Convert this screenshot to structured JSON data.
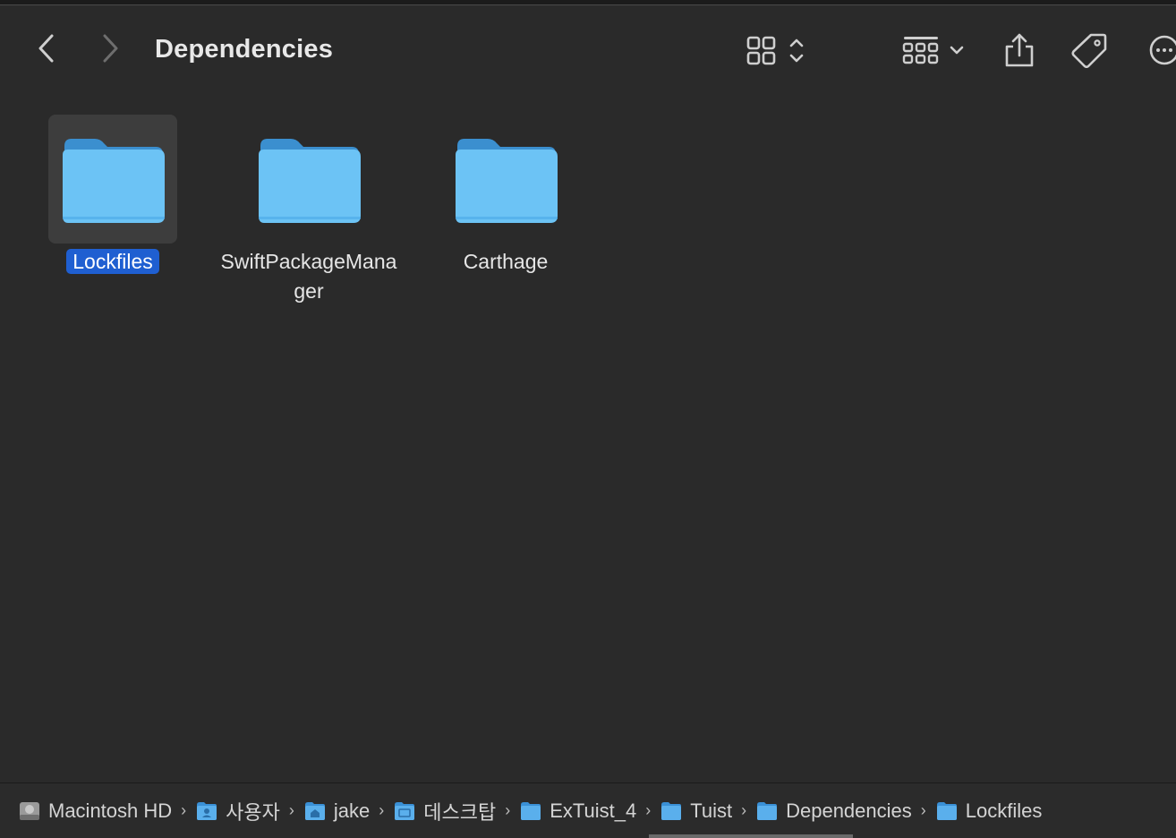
{
  "window": {
    "title": "Dependencies"
  },
  "toolbar": {
    "back_icon": "chevron-left-icon",
    "forward_icon": "chevron-right-icon",
    "view_icon": "icon-grid-view-icon",
    "group_icon": "group-by-icon",
    "share_icon": "share-icon",
    "tag_icon": "tag-icon",
    "more_icon": "ellipsis-circle-icon"
  },
  "items": [
    {
      "name": "Lockfiles",
      "icon": "folder-icon",
      "selected": true
    },
    {
      "name": "SwiftPackageManager",
      "icon": "folder-icon",
      "selected": false
    },
    {
      "name": "Carthage",
      "icon": "folder-icon",
      "selected": false
    }
  ],
  "pathbar": [
    {
      "label": "Macintosh HD",
      "icon": "hard-drive-icon"
    },
    {
      "label": "사용자",
      "icon": "users-folder-icon"
    },
    {
      "label": "jake",
      "icon": "home-folder-icon"
    },
    {
      "label": "데스크탑",
      "icon": "desktop-folder-icon"
    },
    {
      "label": "ExTuist_4",
      "icon": "folder-icon"
    },
    {
      "label": "Tuist",
      "icon": "folder-icon"
    },
    {
      "label": "Dependencies",
      "icon": "folder-icon"
    },
    {
      "label": "Lockfiles",
      "icon": "folder-icon"
    }
  ],
  "colors": {
    "background": "#2a2a2a",
    "folder_blue": "#6cc3f5",
    "selection": "#1f5fd1"
  }
}
